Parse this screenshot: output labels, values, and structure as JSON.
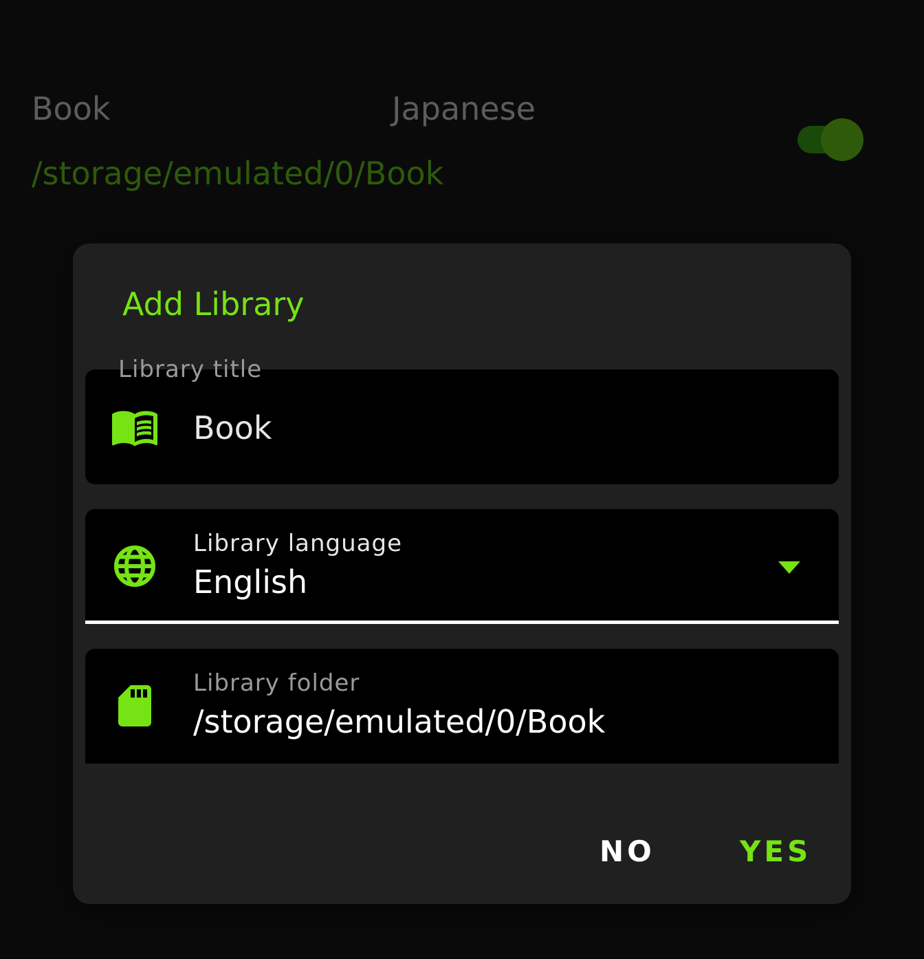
{
  "background_item": {
    "title": "Book",
    "language": "Japanese",
    "path": "/storage/emulated/0/Book",
    "toggle_state": "on"
  },
  "dialog": {
    "title": "Add Library",
    "title_field": {
      "label": "Library title",
      "value": "Book",
      "icon": "book-open-icon"
    },
    "language_field": {
      "label": "Library language",
      "value": "English",
      "icon": "globe-icon"
    },
    "folder_field": {
      "label": "Library folder",
      "value": "/storage/emulated/0/Book",
      "icon": "sd-card-icon"
    },
    "buttons": {
      "no": "NO",
      "yes": "YES"
    }
  },
  "colors": {
    "accent": "#76e314",
    "dialog_bg": "#202020",
    "field_bg": "#000000"
  }
}
